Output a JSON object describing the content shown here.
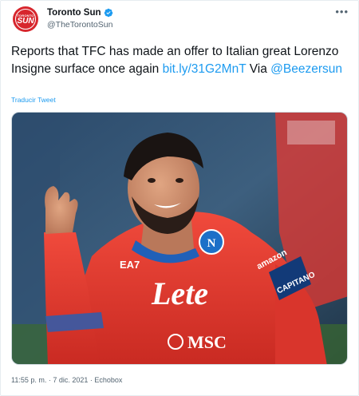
{
  "account": {
    "avatar_text_top": "TORONTO",
    "avatar_text": "SUN",
    "display_name": "Toronto Sun",
    "handle": "@TheTorontoSun"
  },
  "tweet": {
    "text_main": "Reports that TFC has made an offer to Italian great Lorenzo Insigne surface once again ",
    "link": "bit.ly/31G2MnT",
    "text_via": " Via ",
    "mention": "@Beezersun",
    "translate_label": "Traducir Tweet"
  },
  "media": {
    "jersey_sponsor": "Lete",
    "jersey_brand": "EA7",
    "jersey_sponsor2": "MSC",
    "sleeve_brand": "amazon",
    "armband": "CAPITANO",
    "badge_letter": "N"
  },
  "meta": {
    "time": "11:55 p. m.",
    "separator": " · ",
    "date": "7 dic. 2021",
    "source": "Echobox"
  },
  "colors": {
    "accent": "#1d9bf0",
    "brand_red": "#d7262d",
    "jersey_red": "#e8372f"
  }
}
